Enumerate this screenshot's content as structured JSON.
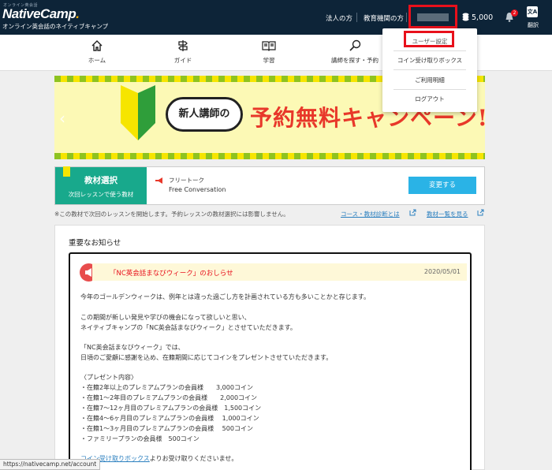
{
  "header": {
    "logo_tag_small": "オンライン英会話",
    "logo_main": "NativeCamp",
    "logo_dot": ".",
    "logo_sub": "オンライン英会話のネイティブキャンプ",
    "link_corporate": "法人の方",
    "link_education": "教育機関の方",
    "coins": "5,000",
    "notification_count": "2",
    "translate_icon_text": "文A",
    "translate_label": "翻訳"
  },
  "nav": {
    "items": [
      {
        "label": "ホーム",
        "icon": "home-icon"
      },
      {
        "label": "ガイド",
        "icon": "signpost-icon"
      },
      {
        "label": "学習",
        "icon": "book-icon"
      },
      {
        "label": "講師を探す・予約",
        "icon": "search-icon"
      }
    ]
  },
  "dropdown": {
    "items": [
      "ユーザー設定",
      "コイン受け取りボックス",
      "ご利用明細",
      "ログアウト"
    ]
  },
  "banner": {
    "bubble": "新人講師の",
    "headline": "予約無料キャンペーン!!",
    "colors": {
      "stripe_green": "#8ec31f",
      "stripe_yellow": "#f6e500",
      "headline": "#e8382a"
    }
  },
  "material": {
    "title": "教材選択",
    "subtitle": "次回レッスンで使う教材",
    "name_ja": "フリートーク",
    "name_en": "Free Conversation",
    "change_button": "変更する"
  },
  "note": "※この教材で次回のレッスンを開始します。予約レッスンの教材選択には影響しません。",
  "links": {
    "diagnosis": "コース・教材診断とは",
    "material_list": "教材一覧を見る"
  },
  "notice": {
    "heading": "重要なお知らせ",
    "title": "「NC英会話まなびウィーク」のおしらせ",
    "date": "2020/05/01",
    "lines": [
      "今年のゴールデンウィークは、例年とは違った過ごし方を計画されている方も多いことかと存じます。",
      "",
      "この期間が新しい発見や学びの機会になって欲しいと思い、",
      "ネイティブキャンプの「NC英会話まなびウィーク」とさせていただきます。",
      "",
      "「NC英会話まなびウィーク」では、",
      "日頃のご愛顧に感謝を込め、在籍期間に応じてコインをプレゼントさせていただきます。",
      "",
      "〈プレゼント内容〉",
      "・在籍2年以上のプレミアムプランの会員様　　3,000コイン",
      "・在籍1〜2年目のプレミアムプランの会員様　　2,000コイン",
      "・在籍7〜12ヶ月目のプレミアムプランの会員様　1,500コイン",
      "・在籍4〜6ヶ月目のプレミアムプランの会員様　 1,000コイン",
      "・在籍1〜3ヶ月目のプレミアムプランの会員様　 500コイン",
      "・ファミリープランの会員様　500コイン"
    ],
    "footer_link": "コイン受け取りボックス",
    "footer_text": "よりお受け取りくださいませ。"
  },
  "status_url": "https://nativecamp.net/account"
}
